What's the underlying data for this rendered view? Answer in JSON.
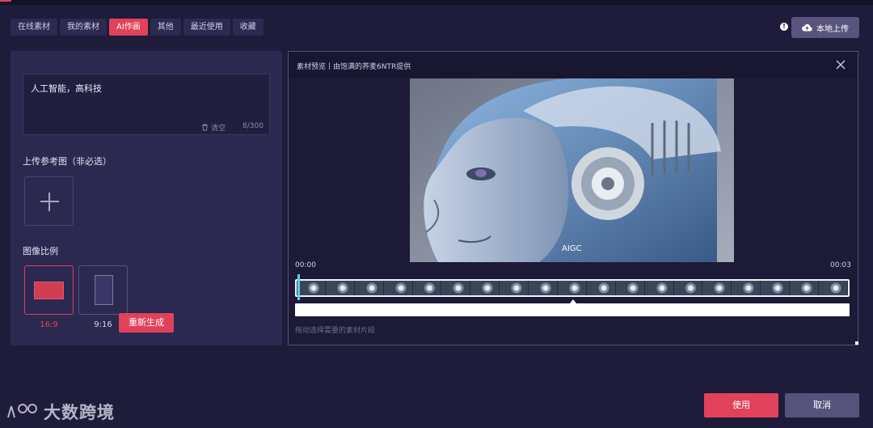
{
  "tabs": [
    {
      "label": "在线素材",
      "active": false
    },
    {
      "label": "我的素材",
      "active": false
    },
    {
      "label": "AI作画",
      "active": true
    },
    {
      "label": "其他",
      "active": false
    },
    {
      "label": "最近使用",
      "active": false
    },
    {
      "label": "收藏",
      "active": false
    }
  ],
  "header": {
    "info_icon": "!",
    "upload_label": "本地上传",
    "upload_icon": "cloud-upload-icon"
  },
  "left_panel": {
    "prompt_text": "人工智能，高科技",
    "clear_label": "清空",
    "counter": "8/300",
    "reference_label": "上传参考图（非必选）",
    "ratio_section_label": "图像比例",
    "ratios": [
      {
        "label": "16:9",
        "selected": true
      },
      {
        "label": "9:16",
        "selected": false
      }
    ],
    "regenerate_label": "重新生成"
  },
  "preview": {
    "title": "素材预览丨由饱满的荞麦6NTR提供",
    "image_caption": "AIGC",
    "time_start": "00:00",
    "time_end": "00:03",
    "hint": "拖动选择需要的素材片段"
  },
  "footer": {
    "use_label": "使用",
    "cancel_label": "取消"
  },
  "watermark": {
    "text": "大数跨境"
  },
  "colors": {
    "accent": "#e2415b",
    "background": "#1e1c3a",
    "panel": "#2b2950",
    "secondary_button": "#56527c"
  }
}
